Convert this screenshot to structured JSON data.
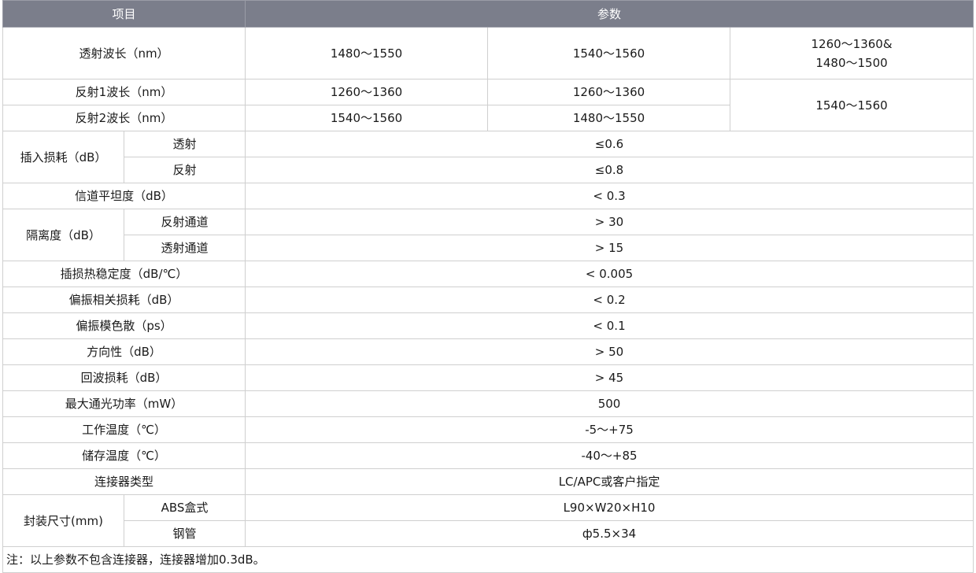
{
  "header": {
    "item": "项目",
    "params": "参数"
  },
  "rows": {
    "trans_wl": {
      "label": "透射波长（nm）",
      "v1": "1480～1550",
      "v2": "1540～1560",
      "v3a": "1260～1360&",
      "v3b": "1480～1500"
    },
    "refl1_wl": {
      "label": "反射1波长（nm）",
      "v1": "1260～1360",
      "v2": "1260～1360",
      "v3": "1540～1560"
    },
    "refl2_wl": {
      "label": "反射2波长（nm）",
      "v1": "1540～1560",
      "v2": "1480～1550"
    },
    "insertion_loss": {
      "label": "插入损耗（dB）",
      "sub1": "透射",
      "val1": "≤0.6",
      "sub2": "反射",
      "val2": "≤0.8"
    },
    "flatness": {
      "label": "信道平坦度（dB）",
      "val": "< 0.3"
    },
    "isolation": {
      "label": "隔离度（dB）",
      "sub1": "反射通道",
      "val1": "> 30",
      "sub2": "透射通道",
      "val2": "> 15"
    },
    "thermal": {
      "label": "插损热稳定度（dB/℃）",
      "val": "< 0.005"
    },
    "pdl": {
      "label": "偏振相关损耗（dB）",
      "val": "< 0.2"
    },
    "pmd": {
      "label": "偏振模色散（ps）",
      "val": "< 0.1"
    },
    "directivity": {
      "label": "方向性（dB）",
      "val": "> 50"
    },
    "return_loss": {
      "label": "回波损耗（dB）",
      "val": "> 45"
    },
    "max_power": {
      "label": "最大通光功率（mW）",
      "val": "500"
    },
    "op_temp": {
      "label": "工作温度（℃）",
      "val": "-5～+75"
    },
    "storage_temp": {
      "label": "储存温度（℃）",
      "val": "-40～+85"
    },
    "connector": {
      "label": "连接器类型",
      "val": "LC/APC或客户指定"
    },
    "package": {
      "label": "封装尺寸(mm)",
      "sub1": "ABS盒式",
      "val1": "L90×W20×H10",
      "sub2": "钢管",
      "val2": "ф5.5×34"
    }
  },
  "note": "注：以上参数不包含连接器，连接器增加0.3dB。"
}
